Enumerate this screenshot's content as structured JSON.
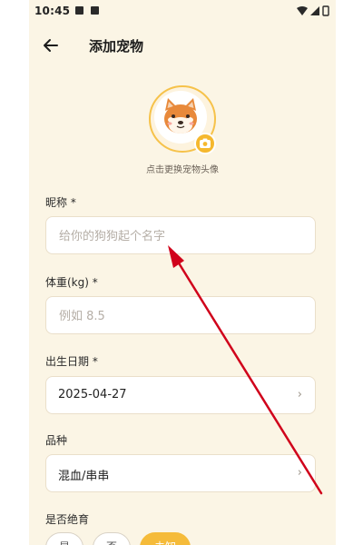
{
  "status_bar": {
    "time": "10:45"
  },
  "header": {
    "title": "添加宠物",
    "back_icon": "arrow-left-icon"
  },
  "avatar": {
    "hint": "点击更换宠物头像",
    "badge_icon": "camera-icon"
  },
  "form": {
    "nickname": {
      "label": "昵称 *",
      "placeholder": "给你的狗狗起个名字",
      "value": ""
    },
    "weight": {
      "label": "体重(kg) *",
      "placeholder": "例如 8.5",
      "value": ""
    },
    "birthdate": {
      "label": "出生日期 *",
      "value": "2025-04-27",
      "chevron": "›"
    },
    "breed": {
      "label": "品种",
      "value": "混血/串串",
      "chevron": "›"
    },
    "neutered": {
      "label": "是否绝育",
      "options": [
        "是",
        "否",
        "未知"
      ],
      "selected": "未知"
    }
  },
  "colors": {
    "accent": "#f5bb3a",
    "background": "#fbf5e5",
    "annotation_arrow": "#d0021b"
  }
}
